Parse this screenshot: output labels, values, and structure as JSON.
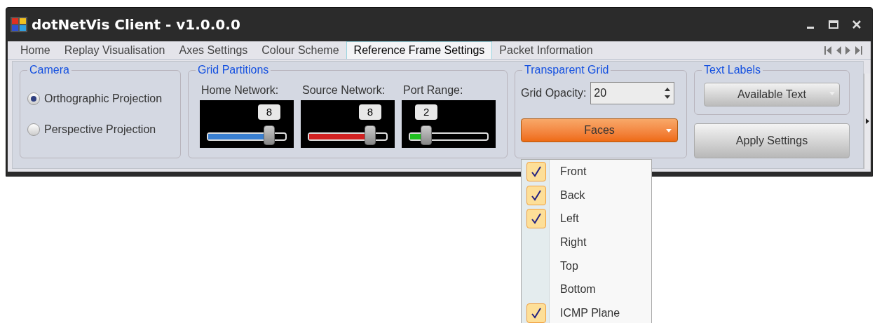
{
  "window": {
    "title": "dotNetVis Client - v1.0.0.0"
  },
  "tabs": [
    {
      "label": "Home",
      "selected": false
    },
    {
      "label": "Replay Visualisation",
      "selected": false
    },
    {
      "label": "Axes Settings",
      "selected": false
    },
    {
      "label": "Colour Scheme",
      "selected": false
    },
    {
      "label": "Reference Frame Settings",
      "selected": true
    },
    {
      "label": "Packet Information",
      "selected": false
    }
  ],
  "camera": {
    "title": "Camera",
    "options": [
      {
        "label": "Orthographic Projection",
        "selected": true
      },
      {
        "label": "Perspective Projection",
        "selected": false
      }
    ]
  },
  "grid_partitions": {
    "title": "Grid Partitions",
    "sliders": [
      {
        "label": "Home Network:",
        "value": "8",
        "level": 0.78,
        "color": "#3a7fd0"
      },
      {
        "label": "Source Network:",
        "value": "8",
        "level": 0.78,
        "color": "#d02020"
      },
      {
        "label": "Port Range:",
        "value": "2",
        "level": 0.22,
        "color": "#20c020"
      }
    ]
  },
  "transparent_grid": {
    "title": "Transparent Grid",
    "opacity_label": "Grid Opacity:",
    "opacity_value": "20",
    "faces_button": "Faces"
  },
  "text_labels": {
    "title": "Text Labels",
    "dropdown": "Available Text"
  },
  "apply_button": "Apply Settings",
  "faces_menu": [
    {
      "label": "Front",
      "checked": true
    },
    {
      "label": "Back",
      "checked": true
    },
    {
      "label": "Left",
      "checked": true
    },
    {
      "label": "Right",
      "checked": false
    },
    {
      "label": "Top",
      "checked": false
    },
    {
      "label": "Bottom",
      "checked": false
    },
    {
      "label": "ICMP Plane",
      "checked": true
    }
  ]
}
